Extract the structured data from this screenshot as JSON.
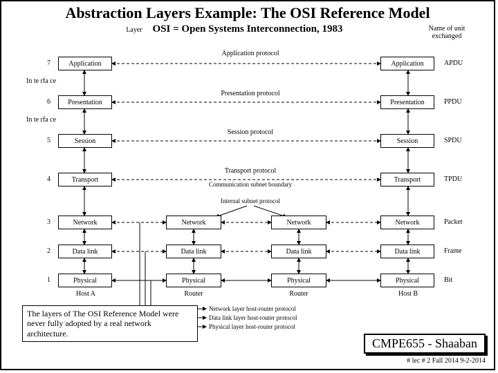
{
  "title": "Abstraction Layers Example: The OSI Reference Model",
  "subtitle": "OSI  = Open Systems Interconnection, 1983",
  "column_headers": {
    "layer": "Layer",
    "unit": "Name of unit\nexchanged"
  },
  "interface_label": "In te rfa ce",
  "layers": [
    {
      "num": "7",
      "name": "Application",
      "protocol": "Application protocol",
      "unit": "APDU"
    },
    {
      "num": "6",
      "name": "Presentation",
      "protocol": "Presentation protocol",
      "unit": "PPDU"
    },
    {
      "num": "5",
      "name": "Session",
      "protocol": "Session protocol",
      "unit": "SPDU"
    },
    {
      "num": "4",
      "name": "Transport",
      "protocol": "Transport protocol",
      "unit": "TPDU"
    },
    {
      "num": "3",
      "name": "Network",
      "unit": "Packet"
    },
    {
      "num": "2",
      "name": "Data link",
      "unit": "Frame"
    },
    {
      "num": "1",
      "name": "Physical",
      "unit": "Bit"
    }
  ],
  "subnet_boundary": "Communication subnet boundary",
  "internal_proto": "Internal subnet protocol",
  "router": "Router",
  "hostA": "Host A",
  "hostB": "Host B",
  "footnotes": {
    "net": "Network layer host-router protocol",
    "dl": "Data link layer host-router protocol",
    "phys": "Physical layer host-router protocol"
  },
  "note": "The layers of The OSI Reference Model were never fully adopted  by a real network architecture.",
  "footer": "CMPE655 - Shaaban",
  "footer_sub": "#  lec # 2    Fall 2014   9-2-2014"
}
